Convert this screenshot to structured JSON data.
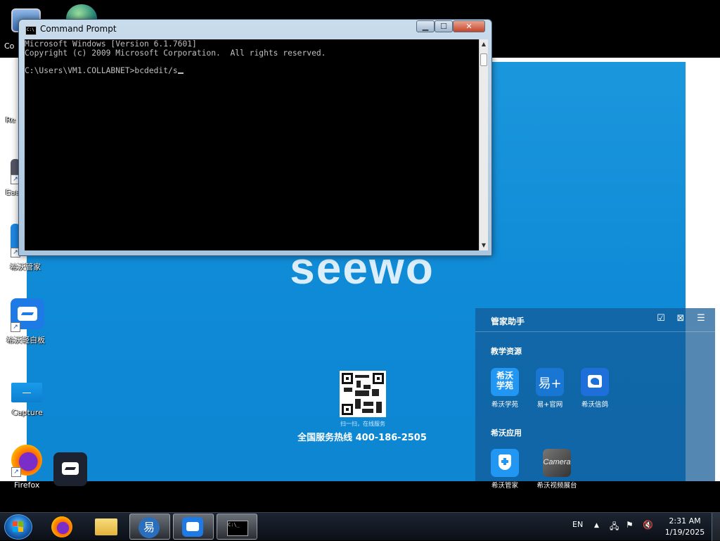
{
  "cmd_window": {
    "title": "Command Prompt",
    "icon_label": "C:\\",
    "lines": [
      "Microsoft Windows [Version 6.1.7601]",
      "Copyright (c) 2009 Microsoft Corporation.  All rights reserved.",
      "",
      "C:\\Users\\VM1.COLLABNET>bcdedit/s"
    ],
    "controls": {
      "minimize_icon": "minimize-icon",
      "maximize_icon": "maximize-icon",
      "close_icon": "close-icon"
    }
  },
  "wallpaper": {
    "brand": "seewo",
    "qr_caption": "扫一扫，在线服务",
    "hotline": "全国服务热线 400-186-2505"
  },
  "desktop_icons": [
    {
      "label": "Co",
      "icon": "computer-icon"
    },
    {
      "label": "Re",
      "icon": "recycle-bin-icon"
    },
    {
      "label": "Eas",
      "icon": "easi-icon"
    },
    {
      "label": "希沃管家",
      "icon": "seewo-manager-icon"
    },
    {
      "label": "希沃轻白板",
      "icon": "seewo-whiteboard-icon"
    },
    {
      "label": "Capture",
      "icon": "capture-icon"
    },
    {
      "label": "Firefox",
      "icon": "firefox-icon"
    }
  ],
  "assistant_panel": {
    "title": "管家助手",
    "tools": [
      "edit-icon",
      "check-icon",
      "menu-icon"
    ],
    "section1_title": "教学资源",
    "section1_apps": [
      {
        "label": "希沃学苑",
        "tile_text": "希沃\n学苑",
        "icon": "seewo-academy-icon",
        "color": "#1e88e5"
      },
      {
        "label": "易+官网",
        "tile_text": "易+",
        "icon": "yi-plus-icon",
        "color": "#1976d2"
      },
      {
        "label": "希沃信鸽",
        "tile_text": "",
        "icon": "seewo-pigeon-icon",
        "color": "#1e6fd9"
      }
    ],
    "section2_title": "希沃应用",
    "section2_apps": [
      {
        "label": "希沃管家",
        "tile_text": "",
        "icon": "shield-icon",
        "color": "#1e88e5"
      },
      {
        "label": "希沃视频展台",
        "tile_text": "Camera",
        "icon": "camera-icon",
        "color": "#555555"
      }
    ]
  },
  "taskbar": {
    "start_icon": "windows-start-icon",
    "items": [
      {
        "name": "firefox",
        "icon": "firefox-icon",
        "active": false
      },
      {
        "name": "explorer",
        "icon": "folder-icon",
        "active": false
      },
      {
        "name": "yi",
        "icon": "yi-icon",
        "active": true
      },
      {
        "name": "whiteboard",
        "icon": "seewo-whiteboard-icon",
        "active": true
      },
      {
        "name": "cmd",
        "icon": "cmd-icon",
        "active": true
      }
    ],
    "language": "EN",
    "time": "2:31 AM",
    "date": "1/19/2025"
  }
}
